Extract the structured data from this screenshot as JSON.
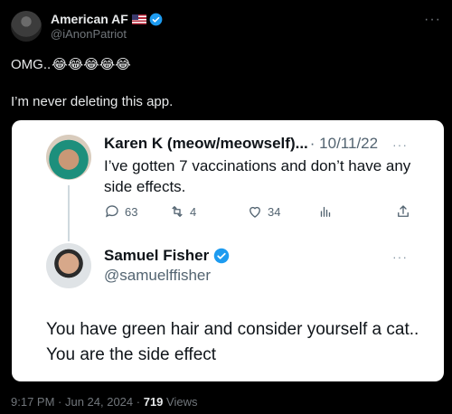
{
  "tweet": {
    "display_name": "American AF",
    "handle": "@iAnonPatriot",
    "line1": "OMG..",
    "emojis": "😂😂😂😂😂",
    "line2": "I’m never deleting this app.",
    "more_icon": "more-icon"
  },
  "embedded": {
    "reply_to": {
      "name": "Karen K (meow/meowself)...",
      "date": "· 10/11/22",
      "text": "I’ve gotten 7 vaccinations and don’t have any side effects.",
      "replies": "63",
      "retweets": "4",
      "likes": "34"
    },
    "reply": {
      "name": "Samuel Fisher",
      "handle": "@samuelffisher",
      "text": "You have green hair and consider yourself a cat.. You are the side effect"
    }
  },
  "meta": {
    "time_date": "9:17 PM · Jun 24, 2024 ·",
    "views_count": "719",
    "views_label": "Views"
  },
  "colors": {
    "background": "#000000",
    "verified": "#1d9bf0",
    "card": "#ffffff"
  }
}
